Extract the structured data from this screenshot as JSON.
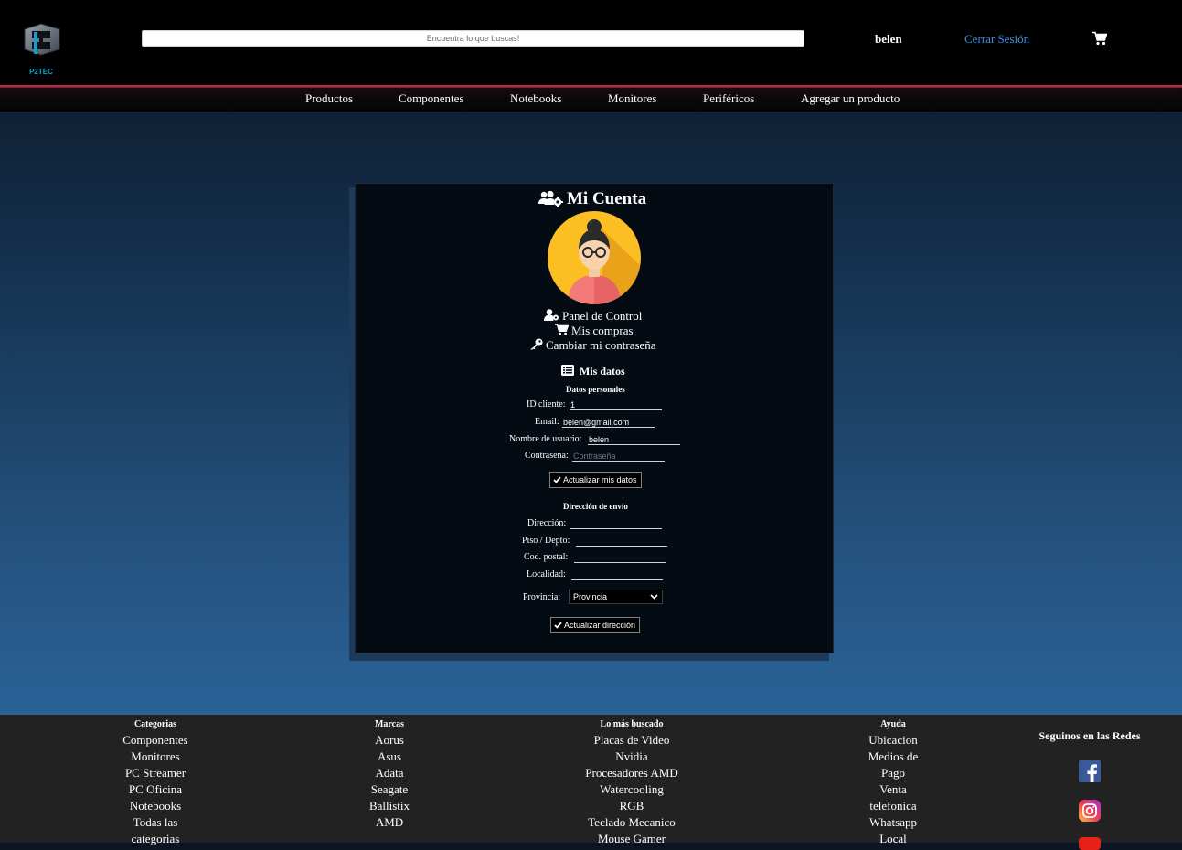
{
  "header": {
    "logo_text": "P2TEC",
    "search_placeholder": "Encuentra lo que buscas!",
    "user_name": "belen",
    "logout_label": "Cerrar Sesión"
  },
  "nav": {
    "items": [
      "Productos",
      "Componentes",
      "Notebooks",
      "Monitores",
      "Periféricos",
      "Agregar un producto"
    ]
  },
  "account": {
    "title": "Mi Cuenta",
    "links": {
      "panel": "Panel de Control",
      "purchases": "Mis compras",
      "password": "Cambiar mi contraseña"
    },
    "my_data_title": "Mis datos",
    "personal": {
      "heading": "Datos personales",
      "client_id_label": "ID cliente:",
      "client_id_value": "1",
      "email_label": "Email:",
      "email_value": "belen@gmail.com",
      "username_label": "Nombre de usuario:",
      "username_value": "belen",
      "password_label": "Contraseña:",
      "password_placeholder": "Contraseña",
      "update_button": "Actualizar mis datos"
    },
    "shipping": {
      "heading": "Dirección de envío",
      "address_label": "Dirección:",
      "floor_label": "Piso / Depto:",
      "postal_label": "Cod. postal:",
      "city_label": "Localidad:",
      "province_label": "Provincia:",
      "province_value": "Provincia",
      "update_button": "Actualizar dirección"
    }
  },
  "footer": {
    "columns": [
      {
        "heading": "Categorias",
        "items": [
          "Componentes",
          "Monitores",
          "PC Streamer",
          "PC Oficina",
          "Notebooks",
          "Todas las",
          "categorias"
        ]
      },
      {
        "heading": "Marcas",
        "items": [
          "Aorus",
          "Asus",
          "Adata",
          "Seagate",
          "Ballistix",
          "AMD"
        ]
      },
      {
        "heading": "Lo más buscado",
        "items": [
          "Placas de Video",
          "Nvidia",
          "Procesadores AMD",
          "Watercooling",
          "RGB",
          "Teclado Mecanico",
          "Mouse Gamer"
        ]
      },
      {
        "heading": "Ayuda",
        "items": [
          "Ubicacion",
          "Medios de",
          "Pago",
          "Venta",
          "telefonica",
          "Whatsapp",
          "Local"
        ]
      }
    ],
    "social_title": "Seguinos en las Redes"
  },
  "colors": {
    "accent_link": "#3d8fe8",
    "header_bg": "#000000",
    "divider_red": "#c0394f",
    "footer_bg": "#222222",
    "panel_bg": "#050b12"
  },
  "icons": [
    "users-gear-icon",
    "user-gear-icon",
    "cart-icon",
    "key-icon",
    "list-icon",
    "check-icon",
    "chevron-down-icon",
    "facebook-icon",
    "instagram-icon",
    "youtube-icon"
  ]
}
